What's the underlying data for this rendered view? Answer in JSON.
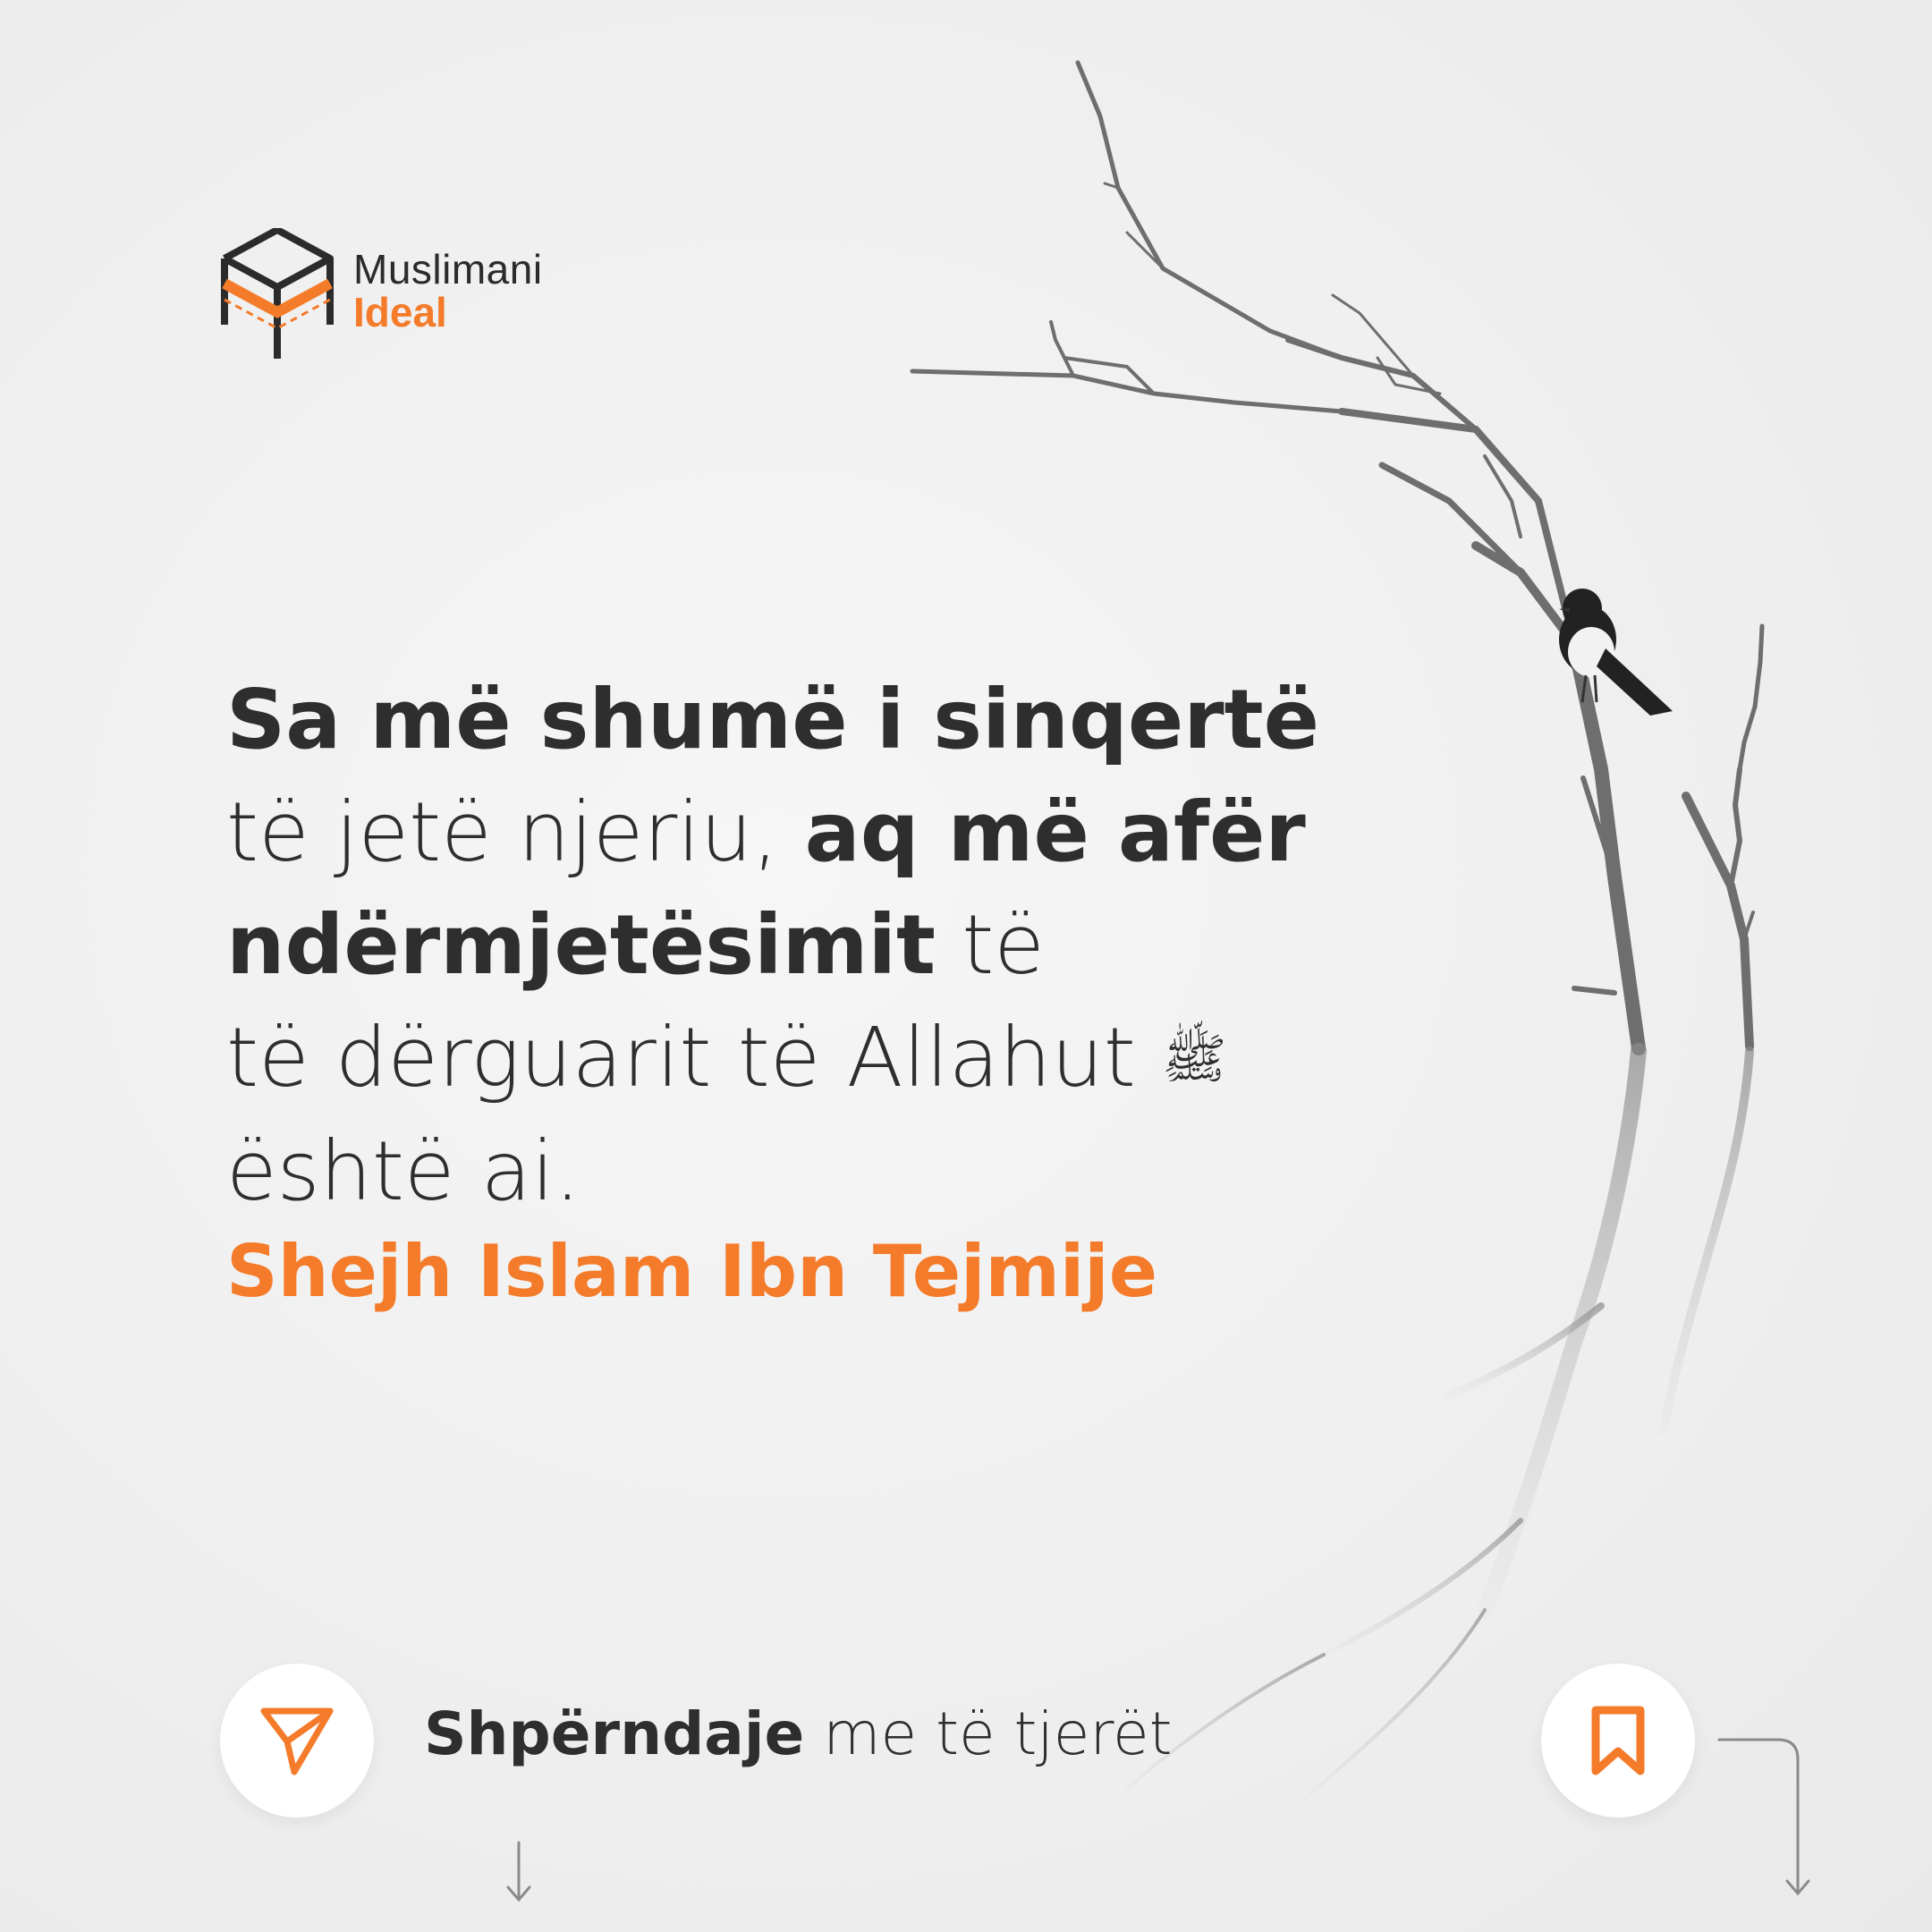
{
  "brand": {
    "name_line1": "Muslimani",
    "name_line2": "Ideal",
    "accent_color": "#f47b2a",
    "text_color": "#2b2b2b"
  },
  "quote": {
    "line1_bold": "Sa më shumë i sinqertë",
    "line2_regular": "të jetë njeriu, ",
    "line2_bold": "aq më afër",
    "line3_bold": "ndërmjetësimit",
    "line3_regular": " të",
    "line4_regular": "të dërguarit të Allahut",
    "honorific": "ﷺ",
    "line5_regular": "është ai."
  },
  "author": "Shejh Islam Ibn Tejmije",
  "footer": {
    "share_bold": "Shpërndaje",
    "share_regular": " me të tjerët",
    "share_icon": "send-icon",
    "save_icon": "bookmark-icon"
  }
}
